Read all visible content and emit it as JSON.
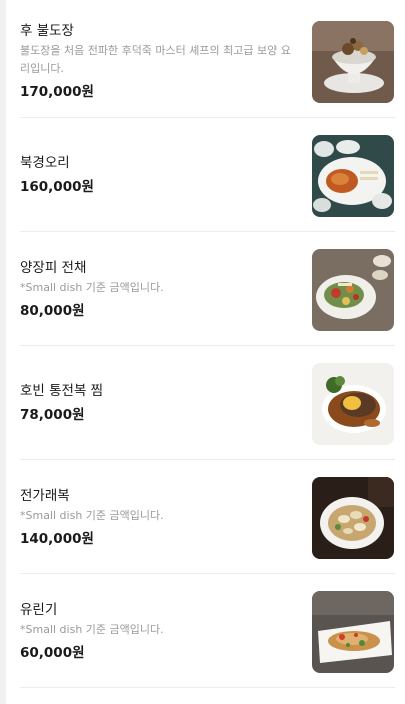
{
  "menu": {
    "items": [
      {
        "name": "후 불도장",
        "desc": "불도장을 처음 전파한 후덕죽 마스터 셰프의 최고급 보양 요리입니다.",
        "price": "170,000원",
        "image": "soup-bowl-photo"
      },
      {
        "name": "북경오리",
        "desc": "",
        "price": "160,000원",
        "image": "peking-duck-photo"
      },
      {
        "name": "양장피 전채",
        "desc": "*Small dish 기준 금액입니다.",
        "price": "80,000원",
        "image": "cold-appetizer-photo"
      },
      {
        "name": "호빈 통전복 찜",
        "desc": "",
        "price": "78,000원",
        "image": "abalone-photo"
      },
      {
        "name": "전가래복",
        "desc": "*Small dish 기준 금액입니다.",
        "price": "140,000원",
        "image": "seafood-stew-photo"
      },
      {
        "name": "유린기",
        "desc": "*Small dish 기준 금액입니다.",
        "price": "60,000원",
        "image": "fried-chicken-photo"
      }
    ]
  }
}
